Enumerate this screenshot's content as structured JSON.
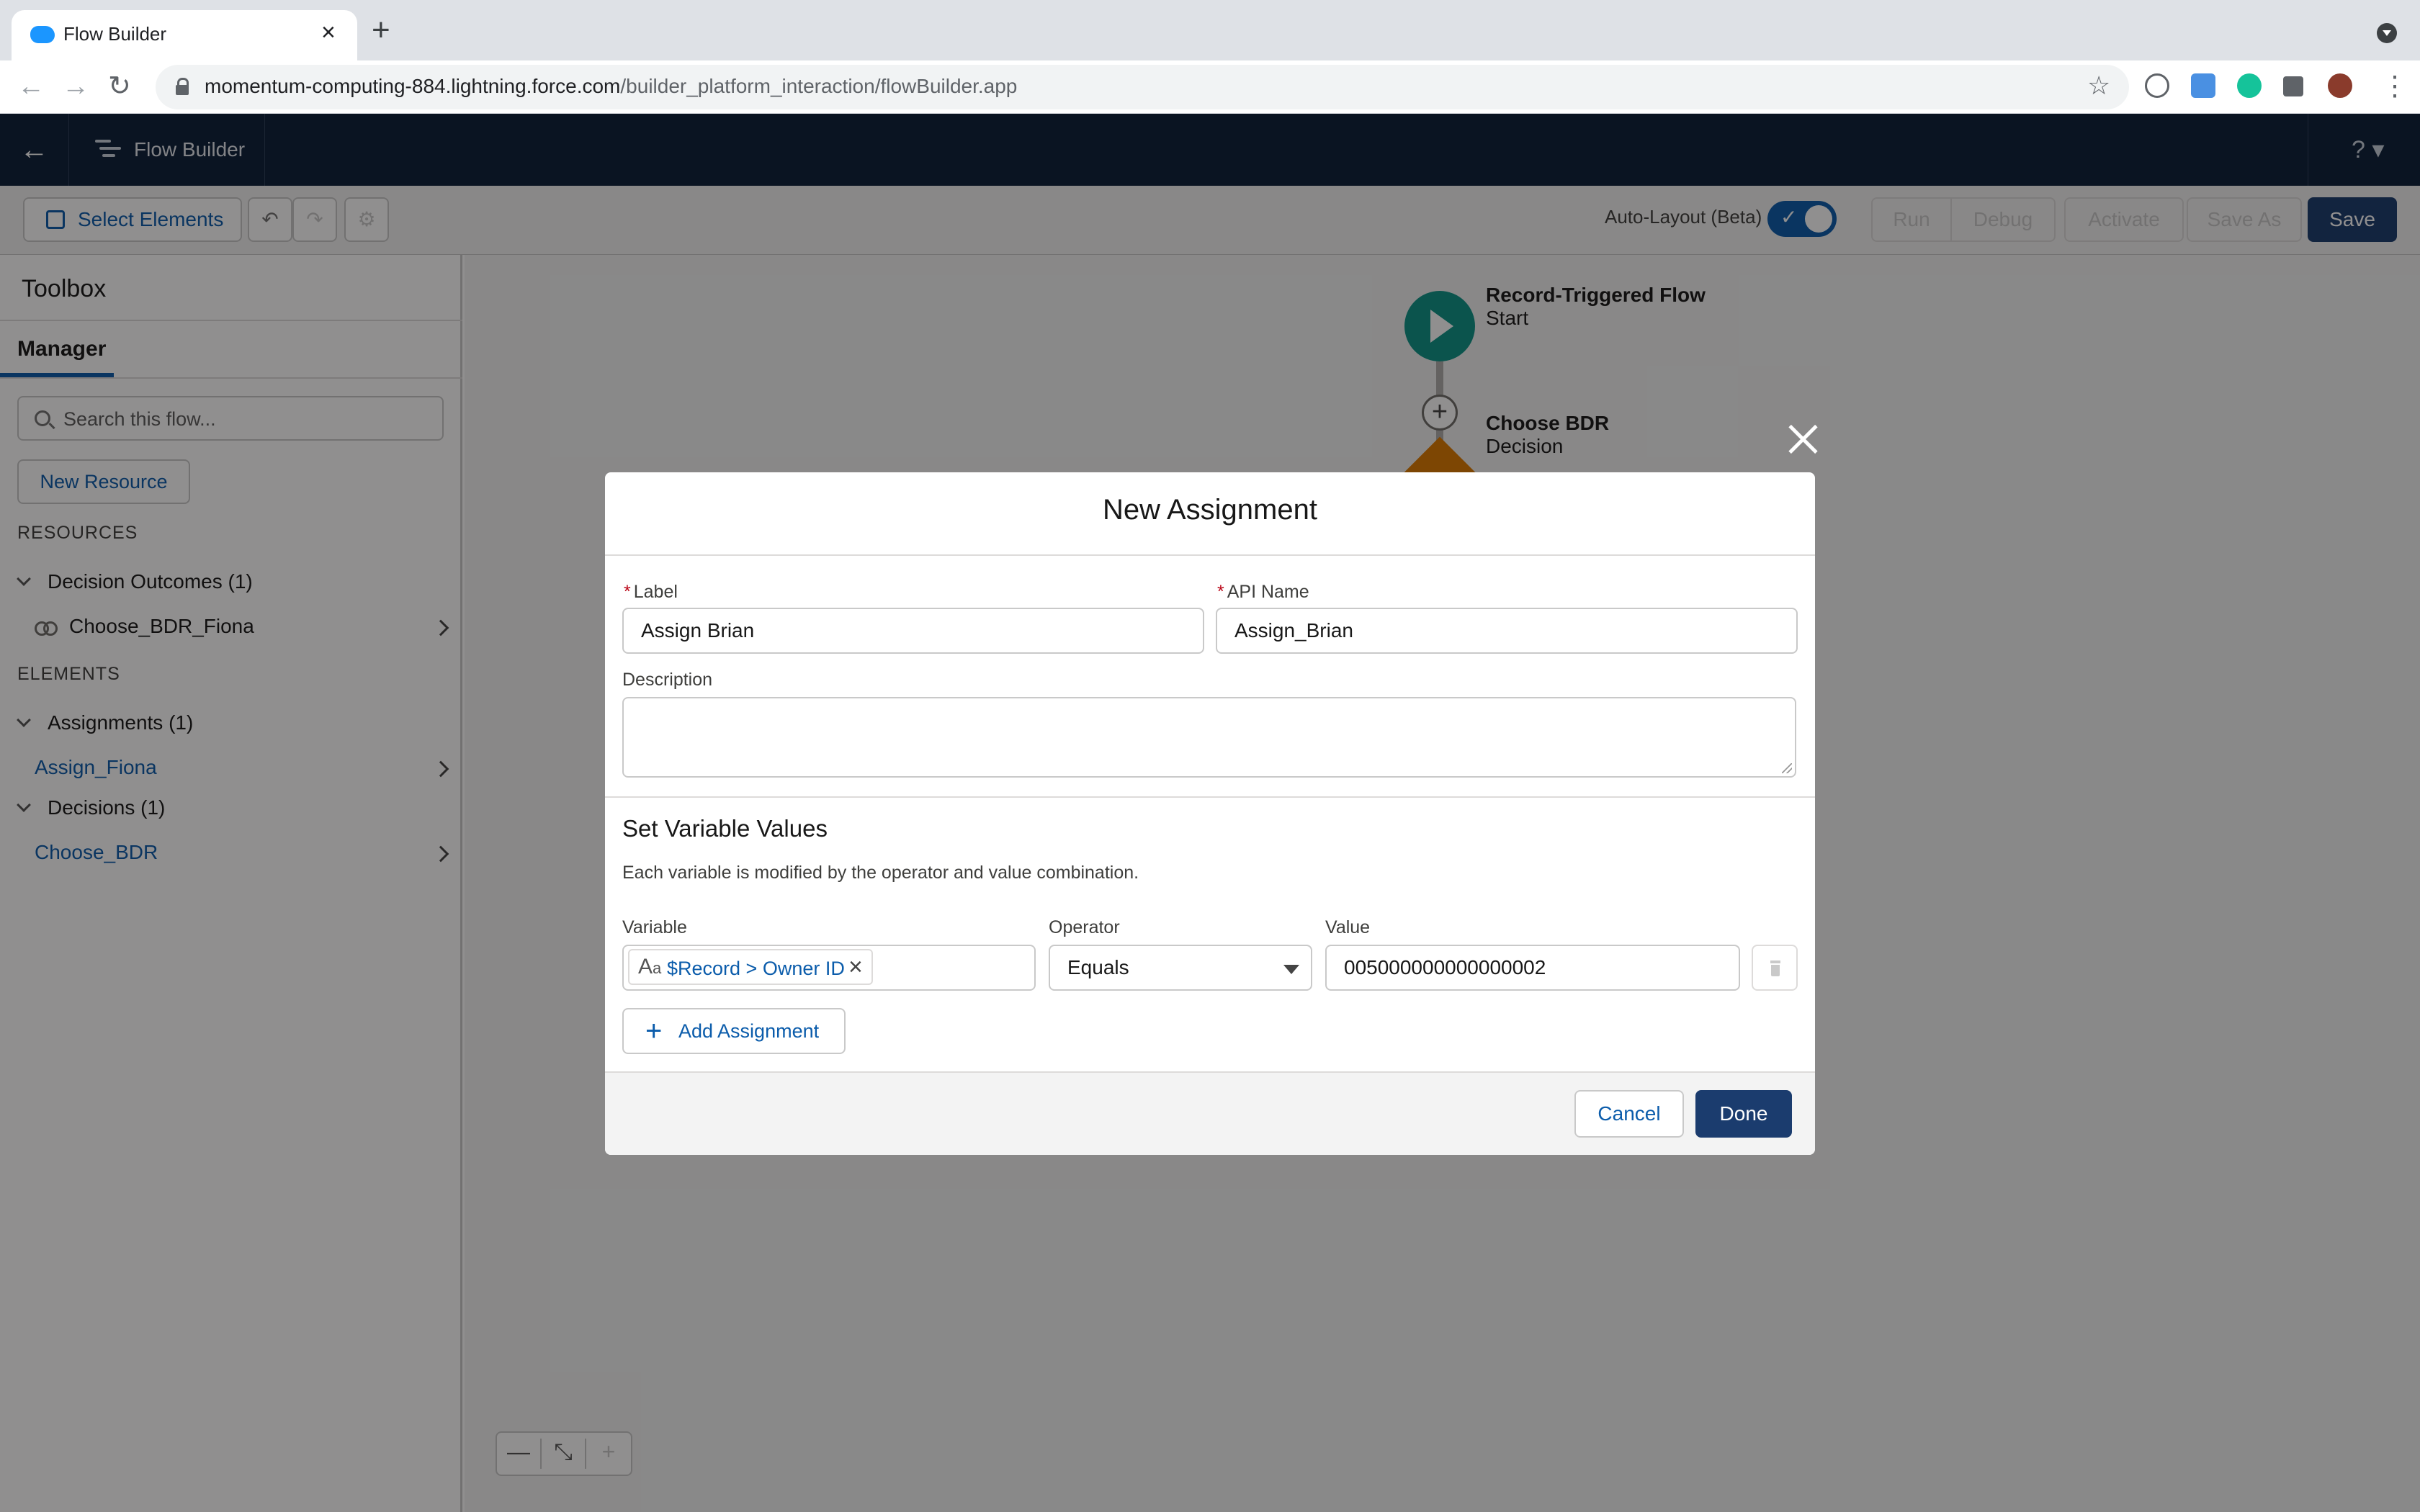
{
  "browser": {
    "tab_title": "Flow Builder",
    "url_host": "momentum-computing-884.lightning.force.com",
    "url_path": "/builder_platform_interaction/flowBuilder.app"
  },
  "header": {
    "app_name": "Flow Builder",
    "help": "?"
  },
  "toolbar": {
    "select_elements": "Select Elements",
    "auto_layout_label": "Auto-Layout (Beta)",
    "auto_layout_on": true,
    "run": "Run",
    "debug": "Debug",
    "activate": "Activate",
    "save_as": "Save As",
    "save": "Save"
  },
  "toolbox": {
    "title": "Toolbox",
    "tab": "Manager",
    "search_placeholder": "Search this flow...",
    "new_resource": "New Resource",
    "resources_heading": "RESOURCES",
    "elements_heading": "ELEMENTS",
    "groups": [
      {
        "label": "Decision Outcomes (1)",
        "items": [
          "Choose_BDR_Fiona"
        ]
      },
      {
        "label": "Assignments (1)",
        "items": [
          "Assign_Fiona"
        ]
      },
      {
        "label": "Decisions (1)",
        "items": [
          "Choose_BDR"
        ]
      }
    ]
  },
  "canvas": {
    "start_title": "Record-Triggered Flow",
    "start_sub": "Start",
    "decision_title": "Choose BDR",
    "decision_sub": "Decision",
    "zoom_out": "—",
    "zoom_fit": "⤡",
    "zoom_in": "+"
  },
  "modal": {
    "title": "New Assignment",
    "label_field": {
      "label": "Label",
      "required": "*",
      "value": "Assign Brian"
    },
    "api_field": {
      "label": "API Name",
      "required": "*",
      "value": "Assign_Brian"
    },
    "description_label": "Description",
    "description_value": "",
    "section_title": "Set Variable Values",
    "section_desc": "Each variable is modified by the operator and value combination.",
    "variable_label": "Variable",
    "variable_value": "$Record > Owner ID",
    "operator_label": "Operator",
    "operator_value": "Equals",
    "value_label": "Value",
    "value_value": "005000000000000002",
    "add_assignment": "Add Assignment",
    "cancel": "Cancel",
    "done": "Done"
  }
}
